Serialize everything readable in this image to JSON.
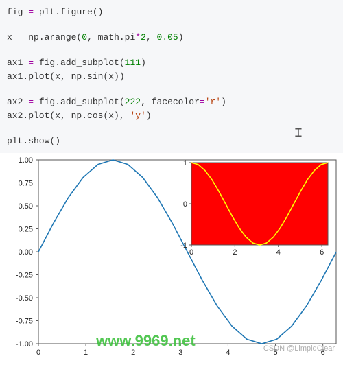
{
  "code": {
    "l1_a": "fig ",
    "l1_op": "=",
    "l1_b": " plt.figure()",
    "l2_a": "x ",
    "l2_op1": "=",
    "l2_b": " np.arange(",
    "l2_n1": "0",
    "l2_c": ", math.pi",
    "l2_op2": "*",
    "l2_n2": "2",
    "l2_d": ", ",
    "l2_n3": "0.05",
    "l2_e": ")",
    "l3_a": "ax1 ",
    "l3_op": "=",
    "l3_b": " fig.add_subplot(",
    "l3_n": "111",
    "l3_c": ")",
    "l4": "ax1.plot(x, np.sin(x))",
    "l5_a": "ax2 ",
    "l5_op": "=",
    "l5_b": " fig.add_subplot(",
    "l5_n": "222",
    "l5_c": ", facecolor",
    "l5_op2": "=",
    "l5_s": "'r'",
    "l5_d": ")",
    "l6_a": "ax2.plot(x, np.cos(x), ",
    "l6_s": "'y'",
    "l6_b": ")",
    "l7": "plt.show()"
  },
  "chart_data": [
    {
      "type": "line",
      "title": "",
      "xlabel": "",
      "ylabel": "",
      "xlim": [
        0,
        6.28
      ],
      "ylim": [
        -1.0,
        1.0
      ],
      "xticks": [
        0,
        1,
        2,
        3,
        4,
        5,
        6
      ],
      "yticks": [
        -1.0,
        -0.75,
        -0.5,
        -0.25,
        0.0,
        0.25,
        0.5,
        0.75,
        1.0
      ],
      "series": [
        {
          "name": "sin(x)",
          "color": "#1f77b4",
          "x": [
            0,
            0.314,
            0.628,
            0.942,
            1.257,
            1.571,
            1.885,
            2.199,
            2.513,
            2.827,
            3.142,
            3.456,
            3.77,
            4.084,
            4.398,
            4.712,
            5.027,
            5.341,
            5.655,
            5.969,
            6.283
          ],
          "y": [
            0,
            0.309,
            0.588,
            0.809,
            0.951,
            1.0,
            0.951,
            0.809,
            0.588,
            0.309,
            0.0,
            -0.309,
            -0.588,
            -0.809,
            -0.951,
            -1.0,
            -0.951,
            -0.809,
            -0.588,
            -0.309,
            0.0
          ]
        }
      ]
    },
    {
      "type": "line",
      "title": "",
      "xlabel": "",
      "ylabel": "",
      "facecolor": "#ff0000",
      "xlim": [
        0,
        6.28
      ],
      "ylim": [
        -1.0,
        1.0
      ],
      "xticks": [
        0,
        2,
        4,
        6
      ],
      "yticks": [
        -1,
        0,
        1
      ],
      "series": [
        {
          "name": "cos(x)",
          "color": "#ffff00",
          "x": [
            0,
            0.314,
            0.628,
            0.942,
            1.257,
            1.571,
            1.885,
            2.199,
            2.513,
            2.827,
            3.142,
            3.456,
            3.77,
            4.084,
            4.398,
            4.712,
            5.027,
            5.341,
            5.655,
            5.969,
            6.283
          ],
          "y": [
            1.0,
            0.951,
            0.809,
            0.588,
            0.309,
            0.0,
            -0.309,
            -0.588,
            -0.809,
            -0.951,
            -1.0,
            -0.951,
            -0.809,
            -0.588,
            -0.309,
            0.0,
            0.309,
            0.588,
            0.809,
            0.951,
            1.0
          ]
        }
      ]
    }
  ],
  "ticks_main_y": [
    "-1.00",
    "-0.75",
    "-0.50",
    "-0.25",
    "0.00",
    "0.25",
    "0.50",
    "0.75",
    "1.00"
  ],
  "ticks_main_x": [
    "0",
    "1",
    "2",
    "3",
    "4",
    "5",
    "6"
  ],
  "ticks_inset_y": [
    "-1",
    "0",
    "1"
  ],
  "ticks_inset_x": [
    "0",
    "2",
    "4",
    "6"
  ],
  "watermark1": "www.9969.net",
  "watermark2": "CSDN @LimpidClear"
}
